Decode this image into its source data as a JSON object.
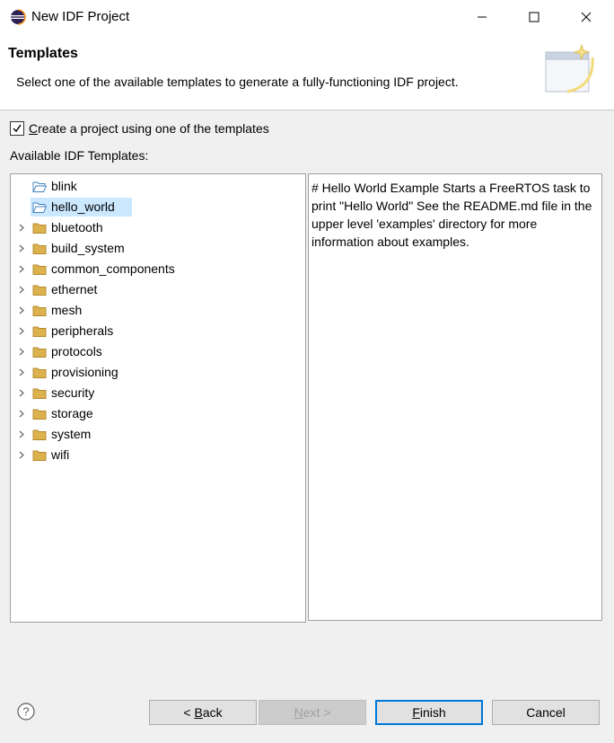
{
  "window": {
    "title": "New IDF Project",
    "minimize_icon": "minimize-icon",
    "maximize_icon": "maximize-icon",
    "close_icon": "close-icon"
  },
  "banner": {
    "title": "Templates",
    "description": "Select one of the available templates to generate a fully-functioning IDF project."
  },
  "options": {
    "use_template_checked": true,
    "use_template_label_first": "C",
    "use_template_label_rest": "reate a project using one of the templates"
  },
  "templates_label": "Available IDF Templates:",
  "tree": {
    "items": [
      {
        "label": "blink",
        "expandable": false,
        "selected": false
      },
      {
        "label": "hello_world",
        "expandable": false,
        "selected": true
      },
      {
        "label": "bluetooth",
        "expandable": true,
        "selected": false
      },
      {
        "label": "build_system",
        "expandable": true,
        "selected": false
      },
      {
        "label": "common_components",
        "expandable": true,
        "selected": false
      },
      {
        "label": "ethernet",
        "expandable": true,
        "selected": false
      },
      {
        "label": "mesh",
        "expandable": true,
        "selected": false
      },
      {
        "label": "peripherals",
        "expandable": true,
        "selected": false
      },
      {
        "label": "protocols",
        "expandable": true,
        "selected": false
      },
      {
        "label": "provisioning",
        "expandable": true,
        "selected": false
      },
      {
        "label": "security",
        "expandable": true,
        "selected": false
      },
      {
        "label": "storage",
        "expandable": true,
        "selected": false
      },
      {
        "label": "system",
        "expandable": true,
        "selected": false
      },
      {
        "label": "wifi",
        "expandable": true,
        "selected": false
      }
    ]
  },
  "description_text": "# Hello World Example Starts a FreeRTOS task to print \"Hello World\" See the README.md file in the upper level 'examples' directory for more information about examples.",
  "buttons": {
    "back_prefix": "< ",
    "back_mnemonic": "B",
    "back_rest": "ack",
    "next_mnemonic": "N",
    "next_rest": "ext >",
    "finish_mnemonic": "F",
    "finish_rest": "inish",
    "cancel": "Cancel"
  },
  "colors": {
    "selection": "#cce8ff",
    "default_button_border": "#0078d7",
    "folder": "#dcb24f"
  }
}
